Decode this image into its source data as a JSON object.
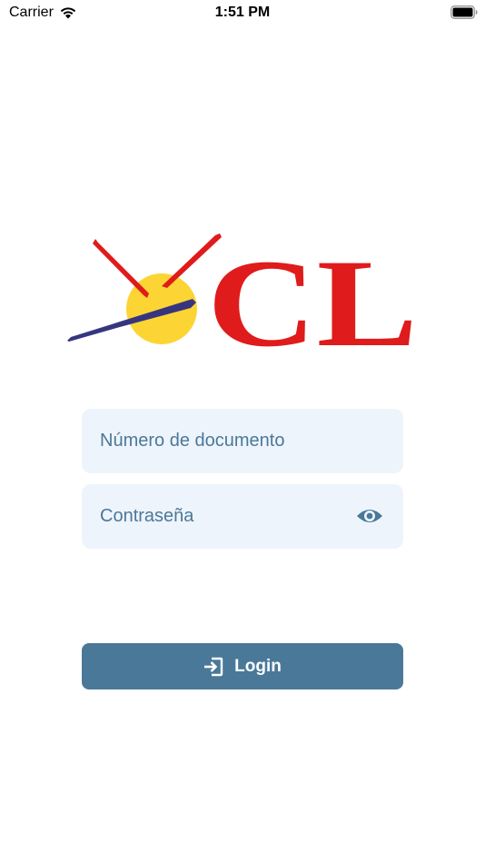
{
  "status_bar": {
    "carrier": "Carrier",
    "time": "1:51 PM",
    "wifi_icon": "wifi-icon",
    "battery_icon": "battery-icon"
  },
  "logo": {
    "text": "CL",
    "colors": {
      "red": "#e01b1b",
      "yellow": "#fcd535",
      "navy": "#36367e"
    }
  },
  "form": {
    "document_placeholder": "Número de documento",
    "document_value": "",
    "password_placeholder": "Contraseña",
    "password_value": "",
    "show_password_icon": "eye-icon"
  },
  "login": {
    "label": "Login",
    "icon": "login-icon"
  },
  "colors": {
    "field_background": "#eef4fb",
    "field_text": "#4b7899",
    "button_background": "#4a7899",
    "button_text": "#ffffff"
  }
}
